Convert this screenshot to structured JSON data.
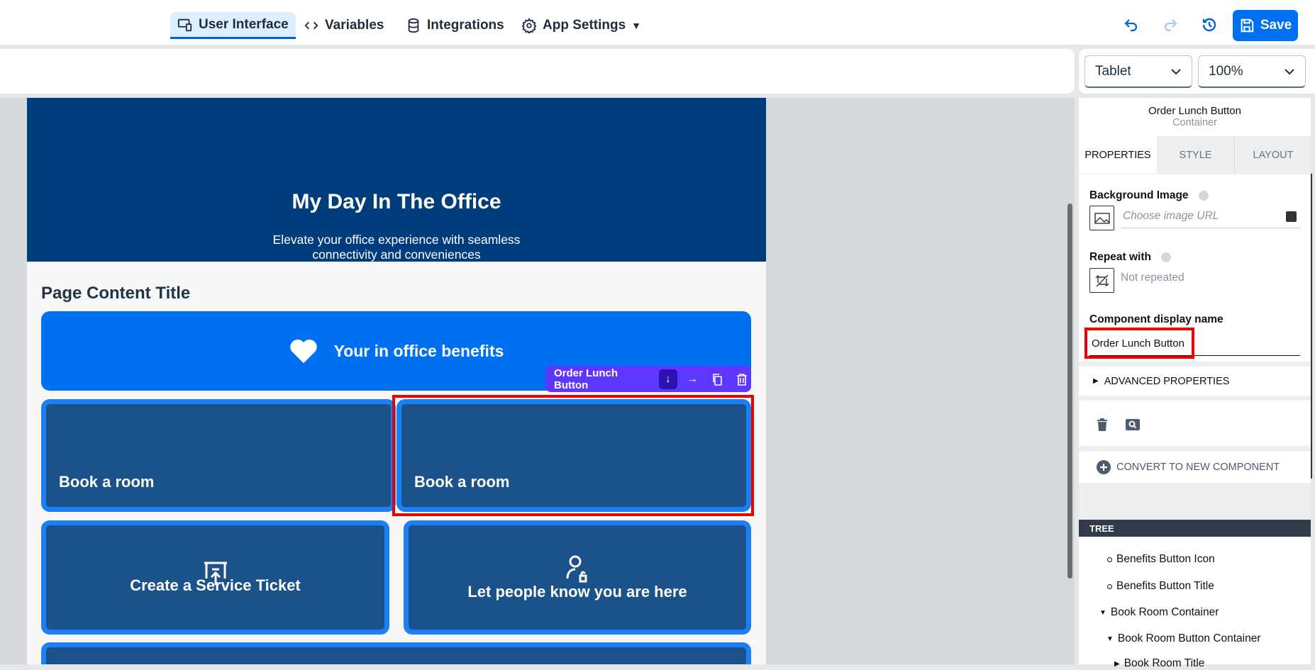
{
  "nav": {
    "tabs": [
      {
        "label": "User Interface",
        "icon": "devices-icon"
      },
      {
        "label": "Variables",
        "icon": "code-icon"
      },
      {
        "label": "Integrations",
        "icon": "database-icon"
      },
      {
        "label": "App Settings",
        "icon": "gear-icon"
      }
    ],
    "save_label": "Save"
  },
  "view": {
    "device": "Tablet",
    "zoom": "100%"
  },
  "canvas": {
    "hero_title": "My Day In The Office",
    "hero_subtitle": "Elevate your office experience with seamless connectivity and conveniences",
    "page_title": "Page Content Title",
    "benefits_label": "Your in office benefits",
    "cards": [
      "Book a room",
      "Book a room",
      "Create a Service Ticket",
      "Let people know you are here"
    ],
    "toolbar_label": "Order Lunch Button"
  },
  "panel": {
    "component_name": "Order Lunch Button",
    "component_type": "Container",
    "tabs": [
      "PROPERTIES",
      "STYLE",
      "LAYOUT"
    ],
    "bg_image_label": "Background Image",
    "bg_image_placeholder": "Choose image URL",
    "repeat_label": "Repeat with",
    "repeat_value": "Not repeated",
    "display_name_label": "Component display name",
    "display_name_value": "Order Lunch Button",
    "advanced": "ADVANCED PROPERTIES",
    "convert": "CONVERT TO NEW COMPONENT",
    "tree_header": "TREE",
    "tree": [
      "Benefits Button Icon",
      "Benefits Button Title",
      "Book Room Container",
      "Book Room Button Container",
      "Book Room Title"
    ]
  },
  "colors": {
    "accent": "#0070f2",
    "hero": "#003d7d",
    "card": "#1a5289",
    "card_border": "#1b7ff5",
    "toolbar": "#5d36ff",
    "selection": "#ee0000"
  }
}
